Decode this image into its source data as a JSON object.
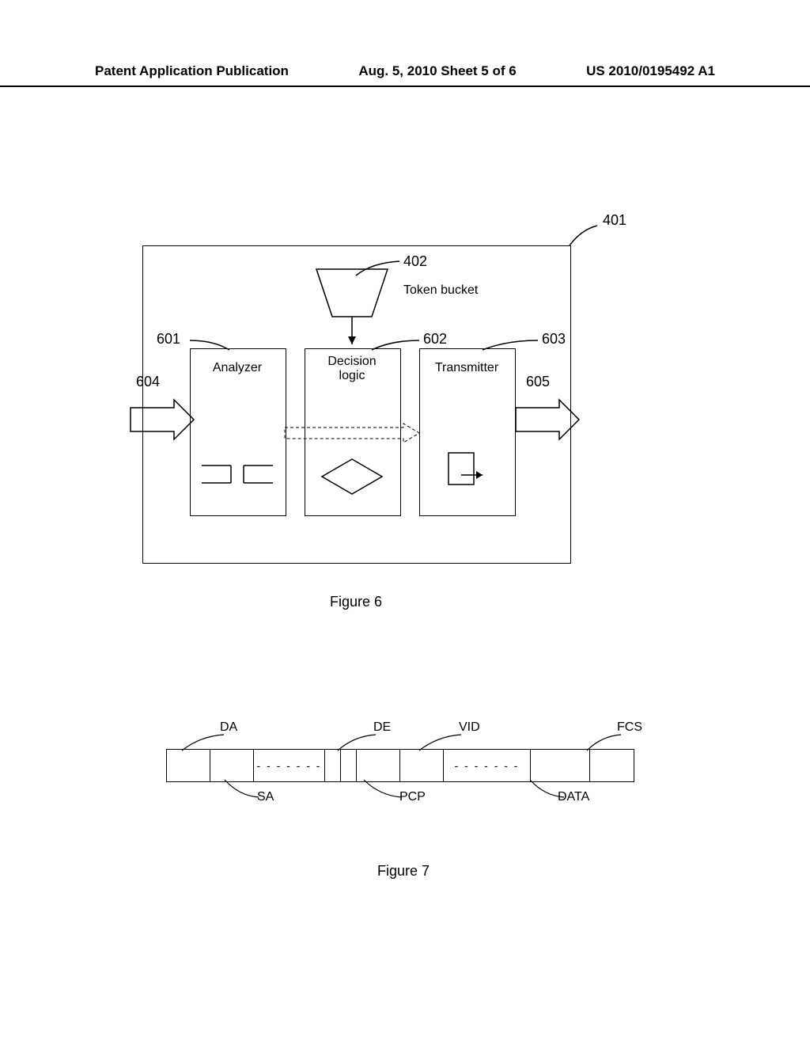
{
  "header": {
    "left": "Patent Application Publication",
    "center": "Aug. 5, 2010  Sheet 5 of 6",
    "right": "US 2010/0195492 A1"
  },
  "fig6": {
    "caption": "Figure 6",
    "token_bucket_label": "Token bucket",
    "ref_401": "401",
    "ref_402": "402",
    "ref_601": "601",
    "ref_602": "602",
    "ref_603": "603",
    "ref_604": "604",
    "ref_605": "605",
    "analyzer": "Analyzer",
    "decision": "Decision\nlogic",
    "transmitter": "Transmitter"
  },
  "fig7": {
    "caption": "Figure 7",
    "da": "DA",
    "sa": "SA",
    "de": "DE",
    "pcp": "PCP",
    "vid": "VID",
    "data": "DATA",
    "fcs": "FCS"
  }
}
